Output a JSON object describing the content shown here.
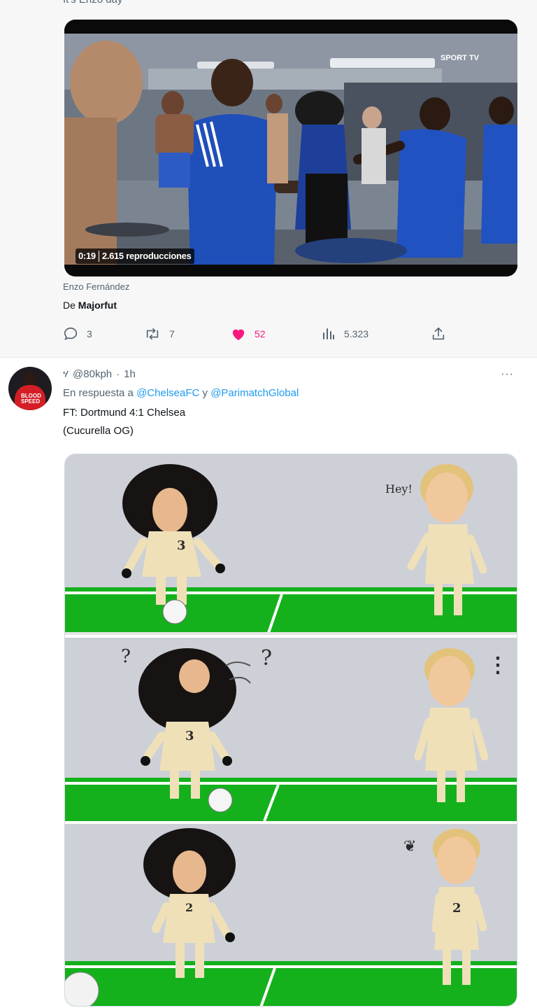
{
  "tweet1": {
    "cut_text": "It's Enzo day",
    "video": {
      "duration": "0:19",
      "views": "2.615 reproducciones",
      "channel_mark": "SPORT TV"
    },
    "credit": "Enzo Fernández",
    "from_prefix": "De",
    "from_source": "Majorfut",
    "actions": {
      "replies": "3",
      "reposts": "7",
      "likes": "52",
      "views": "5.323"
    },
    "like_color": "#f91880"
  },
  "reply": {
    "avatar_label": "BLOOD SPEED",
    "handle_glyph": "ሃ",
    "handle": "@80kph",
    "separator": "·",
    "time": "1h",
    "more": "···",
    "reply_prefix": "En respuesta a",
    "mention1": "@ChelseaFC",
    "conjunction": "y",
    "mention2": "@ParimatchGlobal",
    "line1": "FT: Dortmund 4:1 Chelsea",
    "line2": "(Cucurella OG)",
    "mention_color": "#1d9bf0"
  },
  "comic": {
    "panel1_bubble": "Hey!",
    "panel2_marks": [
      "?",
      "?"
    ],
    "panel2_ellipsis": "⋮",
    "panel3_mark": "❦",
    "shirt_numbers": [
      "3",
      "3",
      "2",
      "2"
    ]
  }
}
